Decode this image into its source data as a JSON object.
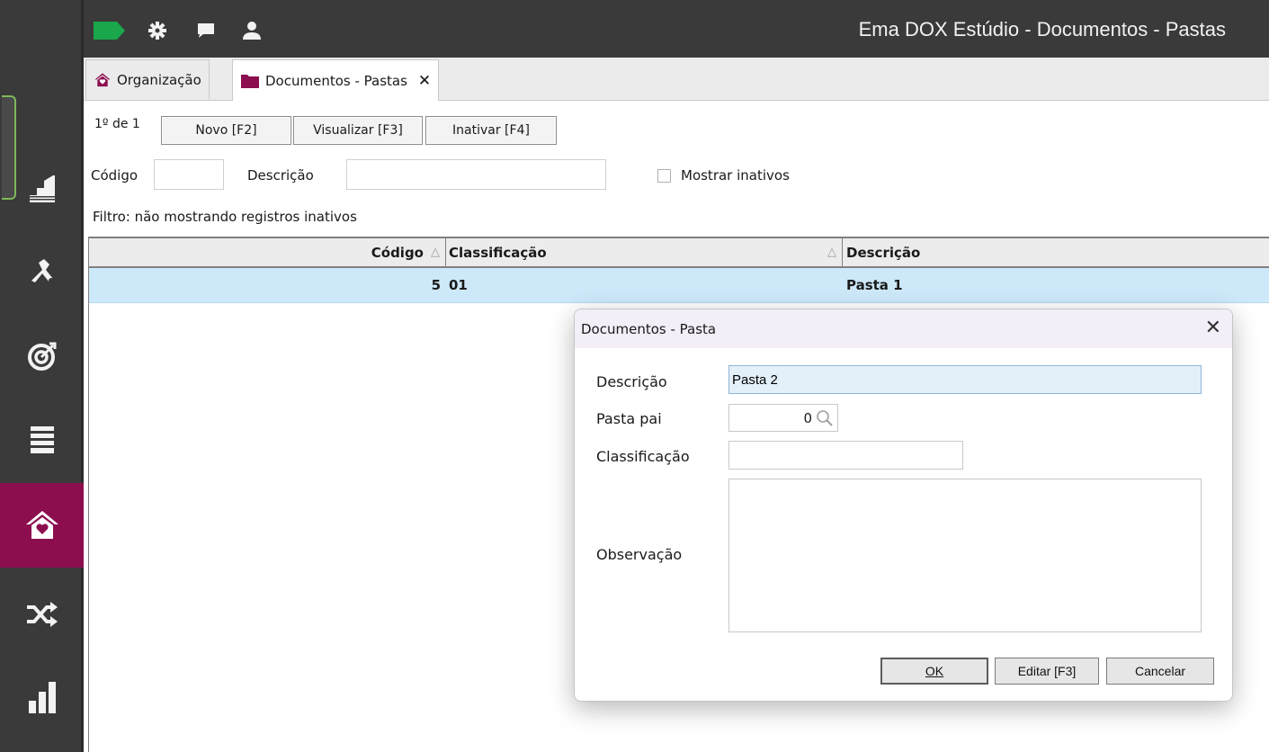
{
  "titlebar": {
    "title": "Ema DOX Estúdio - Documentos - Pastas",
    "brand_color": "#1aa64a",
    "icons": [
      "brand-tag-icon",
      "gear-icon",
      "chat-icon",
      "user-icon"
    ]
  },
  "sidebar": {
    "active_color": "#8c0e4f",
    "items": [
      {
        "name": "stairs-icon",
        "active": false
      },
      {
        "name": "tools-icon",
        "active": false
      },
      {
        "name": "target-icon",
        "active": false
      },
      {
        "name": "list-icon",
        "active": false
      },
      {
        "name": "home-heart-icon",
        "active": true
      },
      {
        "name": "shuffle-icon",
        "active": false
      },
      {
        "name": "bar-chart-icon",
        "active": false
      }
    ]
  },
  "tabs": [
    {
      "label": "Organização",
      "icon": "home-heart-icon",
      "active": false
    },
    {
      "label": "Documentos - Pastas",
      "icon": "folder-icon",
      "active": true,
      "close": "✕"
    }
  ],
  "toolbar": {
    "record_count": "1º de 1",
    "new_label": "Novo [F2]",
    "view_label": "Visualizar [F3]",
    "inactivate_label": "Inativar [F4]"
  },
  "filter": {
    "code_label": "Código",
    "code_value": "",
    "description_label": "Descrição",
    "description_value": "",
    "show_inactive_label": "Mostrar inativos",
    "show_inactive_checked": false,
    "status_text": "Filtro: não mostrando registros inativos"
  },
  "grid": {
    "columns": [
      {
        "label": "Código",
        "sort": "△"
      },
      {
        "label": "Classificação",
        "sort": "△"
      },
      {
        "label": "Descrição",
        "sort": ""
      }
    ],
    "rows": [
      {
        "codigo": "5",
        "classificacao": "01",
        "descricao": "Pasta 1",
        "selected": true
      }
    ]
  },
  "dialog": {
    "title": "Documentos - Pasta",
    "close": "✕",
    "description_label": "Descrição",
    "description_value": "Pasta 2",
    "parent_label": "Pasta pai",
    "parent_value": "0",
    "classification_label": "Classificação",
    "classification_value": "",
    "observation_label": "Observação",
    "observation_value": "",
    "ok_label": "OK",
    "edit_label": "Editar [F3]",
    "cancel_label": "Cancelar"
  }
}
